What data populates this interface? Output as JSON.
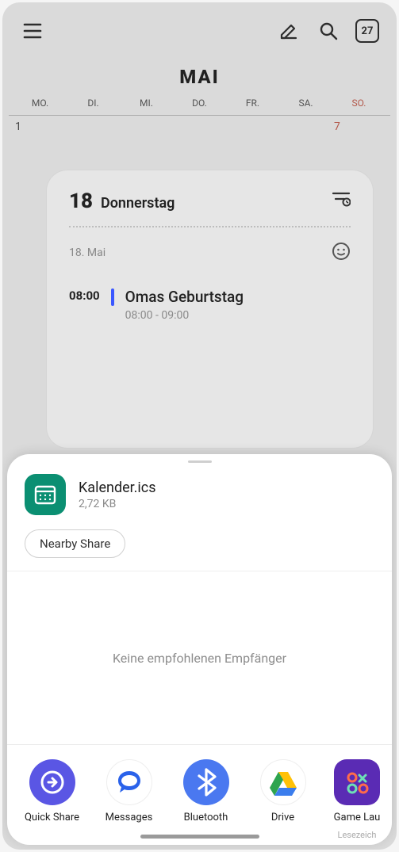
{
  "calendar": {
    "month": "MAI",
    "today_badge": "27",
    "weekdays": [
      "MO.",
      "DI.",
      "MI.",
      "DO.",
      "FR.",
      "SA.",
      "SO."
    ],
    "row1": [
      "1",
      "",
      "",
      "",
      "",
      "",
      "7"
    ]
  },
  "day": {
    "num": "18",
    "name": "Donnerstag",
    "date_label": "18. Mai",
    "event": {
      "time": "08:00",
      "title": "Omas Geburtstag",
      "range": "08:00 - 09:00"
    }
  },
  "share": {
    "file_name": "Kalender.ics",
    "file_size": "2,72 KB",
    "nearby": "Nearby Share",
    "empty": "Keine empfohlenen Empfänger",
    "targets": [
      {
        "label": "Quick Share",
        "sub": ""
      },
      {
        "label": "Messages",
        "sub": ""
      },
      {
        "label": "Bluetooth",
        "sub": ""
      },
      {
        "label": "Drive",
        "sub": ""
      },
      {
        "label": "Game Lau",
        "sub": "Lesezeich"
      }
    ]
  }
}
